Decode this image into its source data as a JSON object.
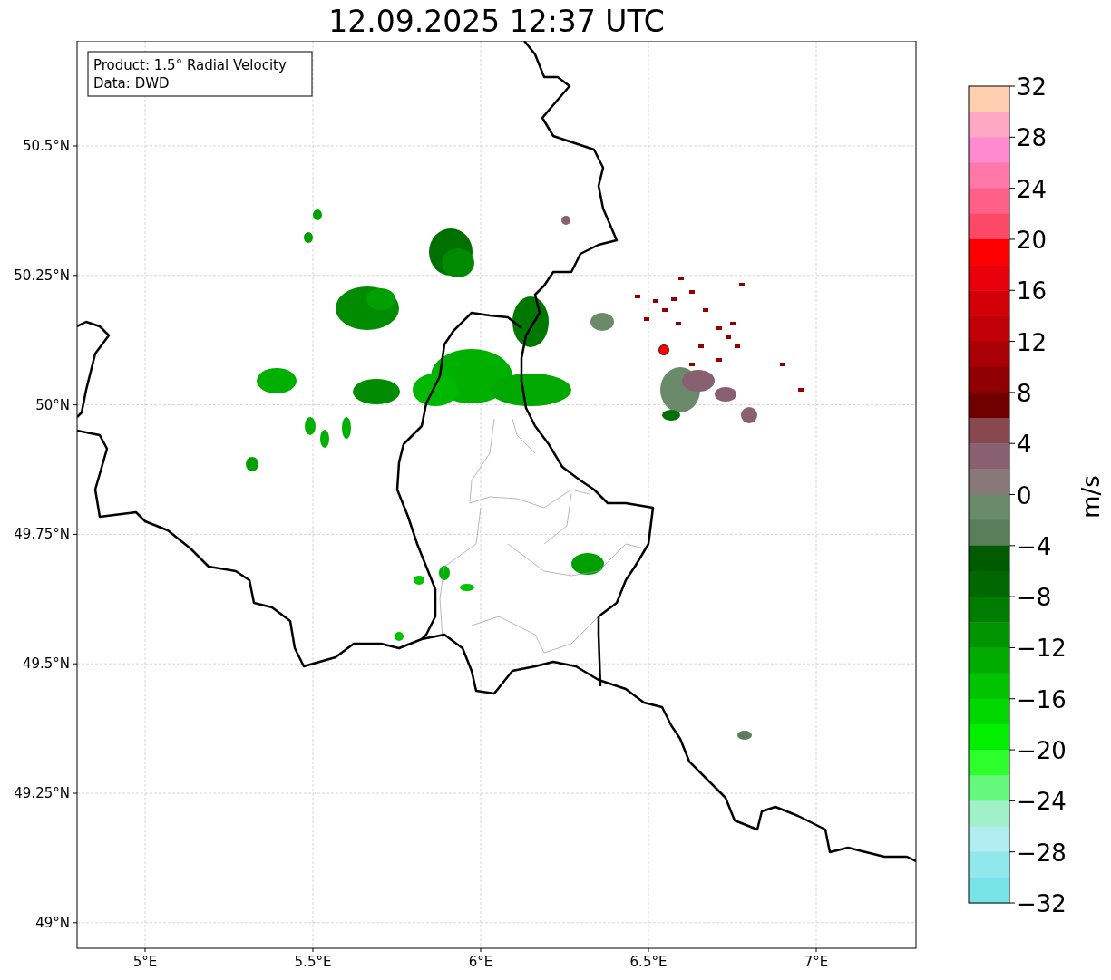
{
  "title": "12.09.2025 12:37 UTC",
  "info_box": [
    "Product: 1.5° Radial Velocity",
    "Data: DWD"
  ],
  "map": {
    "lat_ticks": [
      "50.5°N",
      "50.25°N",
      "50°N",
      "49.75°N",
      "49.5°N",
      "49.25°N",
      "49°N"
    ],
    "lon_ticks": [
      "5°E",
      "5.5°E",
      "6°E",
      "6.5°E",
      "7°E"
    ]
  },
  "colorbar": {
    "label": "m/s",
    "ticks": [
      "32",
      "28",
      "24",
      "20",
      "16",
      "12",
      "8",
      "4",
      "0",
      "−4",
      "−8",
      "−12",
      "−16",
      "−20",
      "−24",
      "−28",
      "−32"
    ],
    "bins": [
      {
        "color": "#ffcfb0"
      },
      {
        "color": "#ffa8c4"
      },
      {
        "color": "#ff8ad0"
      },
      {
        "color": "#ff78a8"
      },
      {
        "color": "#ff6088"
      },
      {
        "color": "#ff4868"
      },
      {
        "color": "#ff0000"
      },
      {
        "color": "#e8000a"
      },
      {
        "color": "#d40008"
      },
      {
        "color": "#c00006"
      },
      {
        "color": "#a80004"
      },
      {
        "color": "#900002"
      },
      {
        "color": "#700000"
      },
      {
        "color": "#884850"
      },
      {
        "color": "#886070"
      },
      {
        "color": "#887878"
      },
      {
        "color": "#6a8a6a"
      },
      {
        "color": "#5a7e5a"
      },
      {
        "color": "#005a00"
      },
      {
        "color": "#006800"
      },
      {
        "color": "#007c00"
      },
      {
        "color": "#009400"
      },
      {
        "color": "#00ac00"
      },
      {
        "color": "#00c400"
      },
      {
        "color": "#00d800"
      },
      {
        "color": "#00f000"
      },
      {
        "color": "#2cff2c"
      },
      {
        "color": "#64f87c"
      },
      {
        "color": "#a0f0c8"
      },
      {
        "color": "#b0ecf0"
      },
      {
        "color": "#90e8ec"
      },
      {
        "color": "#78e4e8"
      }
    ]
  }
}
